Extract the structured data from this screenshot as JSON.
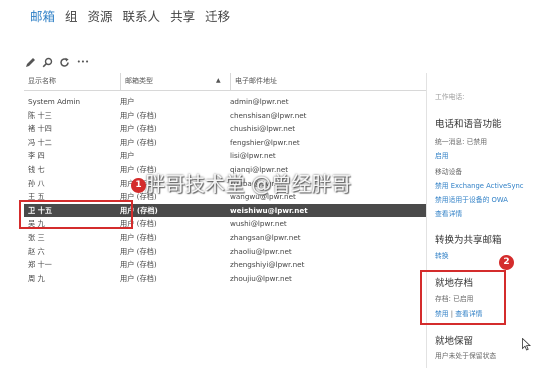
{
  "nav": {
    "items": [
      {
        "label": "邮箱",
        "active": true
      },
      {
        "label": "组",
        "active": false
      },
      {
        "label": "资源",
        "active": false
      },
      {
        "label": "联系人",
        "active": false
      },
      {
        "label": "共享",
        "active": false
      },
      {
        "label": "迁移",
        "active": false
      }
    ]
  },
  "toolbar": {
    "icons": [
      "edit-icon",
      "search-icon",
      "refresh-icon",
      "more-icon"
    ],
    "more_label": "•••"
  },
  "table": {
    "columns": [
      "显示名称",
      "邮箱类型",
      "电子邮件地址"
    ],
    "sort_indicator": "▲",
    "rows": [
      {
        "name": "System Admin",
        "type": "用户",
        "email": "admin@lpwr.net"
      },
      {
        "name": "陈 十三",
        "type": "用户 (存档)",
        "email": "chenshisan@lpwr.net"
      },
      {
        "name": "褚 十四",
        "type": "用户 (存档)",
        "email": "chushisi@lpwr.net"
      },
      {
        "name": "冯 十二",
        "type": "用户 (存档)",
        "email": "fengshier@lpwr.net"
      },
      {
        "name": "李 四",
        "type": "用户",
        "email": "lisi@lpwr.net"
      },
      {
        "name": "钱 七",
        "type": "用户 (存档)",
        "email": "qianqi@lpwr.net"
      },
      {
        "name": "孙 八",
        "type": "用户 (存档)",
        "email": "sunba@lpwr.net"
      },
      {
        "name": "王 五",
        "type": "用户 (存档)",
        "email": "wangwu@lpwr.net"
      },
      {
        "name": "卫 十五",
        "type": "用户 (存档)",
        "email": "weishiwu@lpwr.net",
        "selected": true
      },
      {
        "name": "吴 九",
        "type": "用户 (存档)",
        "email": "wushi@lpwr.net"
      },
      {
        "name": "张 三",
        "type": "用户 (存档)",
        "email": "zhangsan@lpwr.net"
      },
      {
        "name": "赵 六",
        "type": "用户 (存档)",
        "email": "zhaoliu@lpwr.net"
      },
      {
        "name": "郑 十一",
        "type": "用户 (存档)",
        "email": "zhengshiyi@lpwr.net"
      },
      {
        "name": "周 九",
        "type": "用户 (存档)",
        "email": "zhoujiu@lpwr.net"
      }
    ]
  },
  "details": {
    "work_phone": "工作电话:",
    "voice_heading": "电话和语音功能",
    "unified_messaging": "统一消息: 已禁用",
    "enable_link": "启用",
    "mobile_devices": "移动设备",
    "disable_activesync": "禁用 Exchange ActiveSync",
    "disable_owa": "禁用适用于设备的 OWA",
    "view_details": "查看详情",
    "convert_heading": "转换为共享邮箱",
    "convert_link": "转换",
    "archive_heading": "就地存档",
    "archive_status": "存档: 已启用",
    "archive_disable": "禁用",
    "archive_separator": "|",
    "archive_view": "查看详情",
    "hold_heading": "就地保留",
    "hold_status": "用户未处于保留状态"
  },
  "annotations": {
    "badge1": "1",
    "badge2": "2",
    "watermark": "胖哥技术堂 @曾经胖哥"
  },
  "colors": {
    "accent": "#2e7fc6",
    "selected_row": "#4a4a4a",
    "annotation_red": "#d42c2c"
  }
}
